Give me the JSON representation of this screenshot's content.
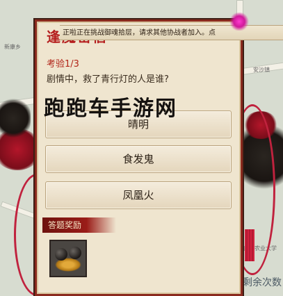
{
  "banner": {
    "text": "正啦正在挑战御魂拾层，请求其他协战者加入。点"
  },
  "dialog": {
    "title": "逢魔密信",
    "question_number": "考验1/3",
    "question": "剧情中，救了青行灯的人是谁?",
    "options": [
      "晴明",
      "食发鬼",
      "凤凰火"
    ],
    "reward_label": "答题奖励"
  },
  "watermark": "跑跑车手游网",
  "map": {
    "labels": [
      "新康乡",
      "安沙镇",
      "南京农业大学"
    ],
    "remaining_text": "剩余次数"
  },
  "colors": {
    "panel_bg": "#efe5cf",
    "border": "#8b2a1e",
    "title": "#b51e1e",
    "accent_red": "#b12418"
  }
}
